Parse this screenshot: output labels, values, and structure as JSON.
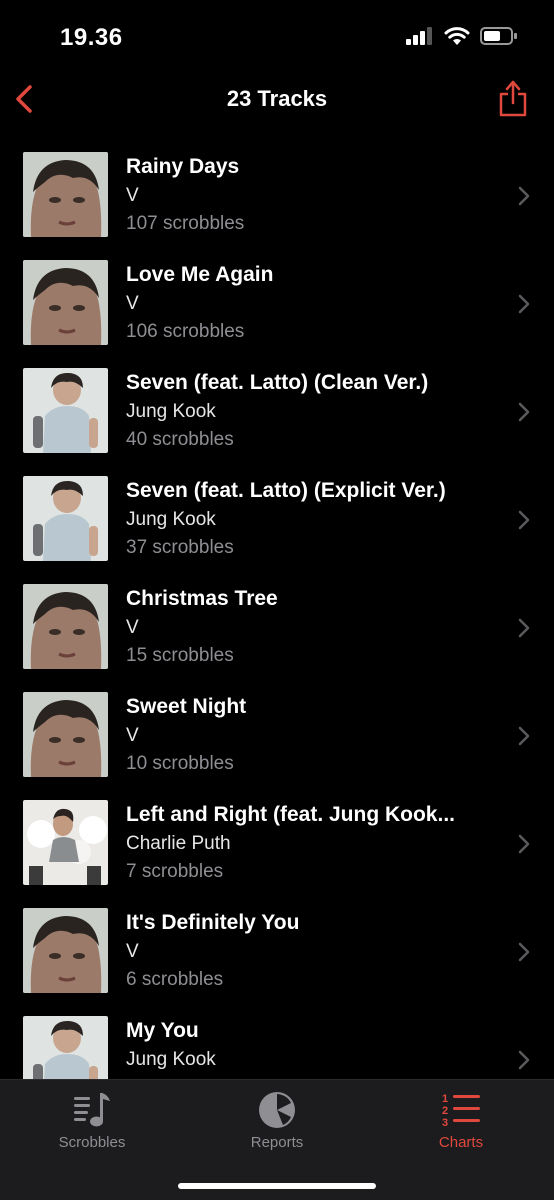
{
  "status": {
    "time": "19.36"
  },
  "nav": {
    "title": "23 Tracks"
  },
  "tracks": [
    {
      "title": "Rainy Days",
      "artist": "V",
      "scrobbles": "107 scrobbles",
      "art": "v"
    },
    {
      "title": "Love Me Again",
      "artist": "V",
      "scrobbles": "106 scrobbles",
      "art": "v"
    },
    {
      "title": "Seven (feat. Latto) (Clean Ver.)",
      "artist": "Jung Kook",
      "scrobbles": "40 scrobbles",
      "art": "jk"
    },
    {
      "title": "Seven (feat. Latto) (Explicit Ver.)",
      "artist": "Jung Kook",
      "scrobbles": "37 scrobbles",
      "art": "jk"
    },
    {
      "title": "Christmas Tree",
      "artist": "V",
      "scrobbles": "15 scrobbles",
      "art": "v"
    },
    {
      "title": "Sweet Night",
      "artist": "V",
      "scrobbles": "10 scrobbles",
      "art": "v"
    },
    {
      "title": "Left and Right (feat. Jung Kook...",
      "artist": "Charlie Puth",
      "scrobbles": "7 scrobbles",
      "art": "cp"
    },
    {
      "title": "It's Definitely You",
      "artist": "V",
      "scrobbles": "6 scrobbles",
      "art": "v"
    },
    {
      "title": "My You",
      "artist": "Jung Kook",
      "scrobbles": "",
      "art": "jk"
    }
  ],
  "tabs": [
    {
      "label": "Scrobbles",
      "icon": "music-note-list-icon",
      "active": false
    },
    {
      "label": "Reports",
      "icon": "pie-chart-icon",
      "active": false
    },
    {
      "label": "Charts",
      "icon": "ranked-list-icon",
      "active": true
    }
  ],
  "colors": {
    "accent": "#e0483e",
    "background": "#000000",
    "tab_bar": "#1c1c1e",
    "inactive": "#8e8e93"
  }
}
